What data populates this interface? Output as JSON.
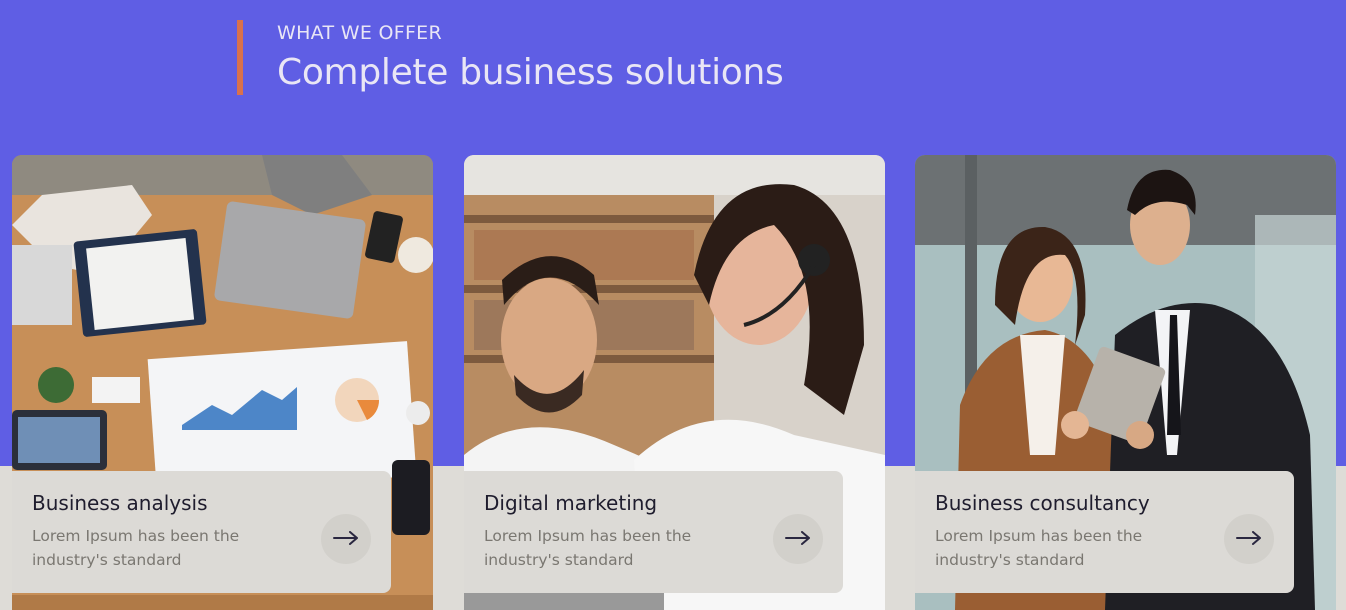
{
  "header": {
    "eyebrow": "WHAT WE OFFER",
    "title": "Complete business solutions"
  },
  "colors": {
    "hero_background": "#5f5ee4",
    "accent_bar": "#d9714c",
    "page_background": "#dedcd7",
    "card_panel": "#dcdad6"
  },
  "cards": [
    {
      "title": "Business analysis",
      "description": "Lorem Ipsum has been the industry's standard",
      "icon": "arrow-right-icon",
      "image": "photo of a team reviewing charts and laptops on a wooden table"
    },
    {
      "title": "Digital marketing",
      "description": "Lorem Ipsum has been the industry's standard",
      "icon": "arrow-right-icon",
      "image": "photo of two support agents wearing headsets"
    },
    {
      "title": "Business consultancy",
      "description": "Lorem Ipsum has been the industry's standard",
      "icon": "arrow-right-icon",
      "image": "photo of two business people looking at a tablet"
    }
  ]
}
